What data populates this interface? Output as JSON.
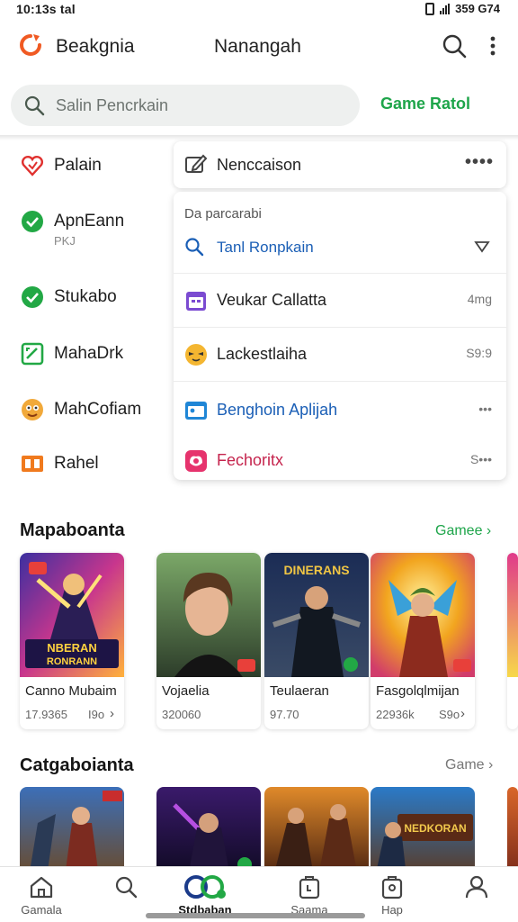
{
  "status_bar": {
    "time": "10:13s tal",
    "right_text": "359 G74"
  },
  "header": {
    "app_name": "Beakgnia",
    "title": "Nanangah"
  },
  "search": {
    "placeholder": "Salin Pencrkain",
    "side_link": "Game Ratol"
  },
  "menu": {
    "items": [
      {
        "label": "Palain",
        "icon": "heart-icon"
      },
      {
        "label": "ApnEann",
        "sub": "PKJ",
        "icon": "check-circle-icon"
      },
      {
        "label": "Stukabo",
        "icon": "check-circle-icon"
      },
      {
        "label": "MahaDrk",
        "icon": "chart-icon"
      },
      {
        "label": "MahCofiam",
        "icon": "face-icon"
      },
      {
        "label": "Rahel",
        "icon": "book-icon"
      }
    ]
  },
  "dropdown": {
    "title": "Nenccaison",
    "more": "••••",
    "hint": "Da parcarabi",
    "search_text": "Tanl Ronpkain",
    "rows": [
      {
        "label": "Veukar Callatta",
        "meta": "4mg",
        "icon": "calendar-icon"
      },
      {
        "label": "Lackestlaiha",
        "meta": "S9:9",
        "icon": "emoji-icon"
      },
      {
        "label": "Benghoin Aplijah",
        "meta": "•••",
        "icon": "app-icon"
      },
      {
        "label": "Fechoritx",
        "meta": "S•••",
        "icon": "pink-app-icon"
      }
    ]
  },
  "sections": [
    {
      "title": "Mapaboanta",
      "link": "Gamee",
      "cards": [
        {
          "name": "Canno Mubaim",
          "stat": "17.9365",
          "stat2": "I9o",
          "thumb_text_top": "NBERAN",
          "thumb_text_bottom": "RONRANN"
        },
        {
          "name": "Vojaelia",
          "stat": "320060",
          "stat2": "",
          "thumb_text_top": "",
          "thumb_text_bottom": ""
        },
        {
          "name": "Teulaeran",
          "stat": "97.70",
          "stat2": "",
          "thumb_text_top": "DINERANS",
          "thumb_text_bottom": ""
        },
        {
          "name": "Fasgolqlmijan",
          "stat": "22936k",
          "stat2": "S9o",
          "thumb_text_top": "",
          "thumb_text_bottom": ""
        }
      ]
    },
    {
      "title": "Catgaboianta",
      "link": "Game",
      "cards": [
        {
          "thumb_text": ""
        },
        {
          "thumb_text": ""
        },
        {
          "thumb_text": ""
        },
        {
          "thumb_text": "NEDKORAN"
        }
      ]
    }
  ],
  "bottom_nav": [
    {
      "label": "Gamala",
      "icon": "home-icon"
    },
    {
      "label": "",
      "icon": "search-icon"
    },
    {
      "label": "Stdbaban",
      "icon": "brand-icon"
    },
    {
      "label": "Saama",
      "icon": "bag-icon"
    },
    {
      "label": "Hap",
      "icon": "store-icon"
    },
    {
      "label": "",
      "icon": "profile-icon"
    }
  ],
  "colors": {
    "accent": "#1ea54a",
    "logo": "#f05a23",
    "link_blue": "#1b5fb6"
  }
}
